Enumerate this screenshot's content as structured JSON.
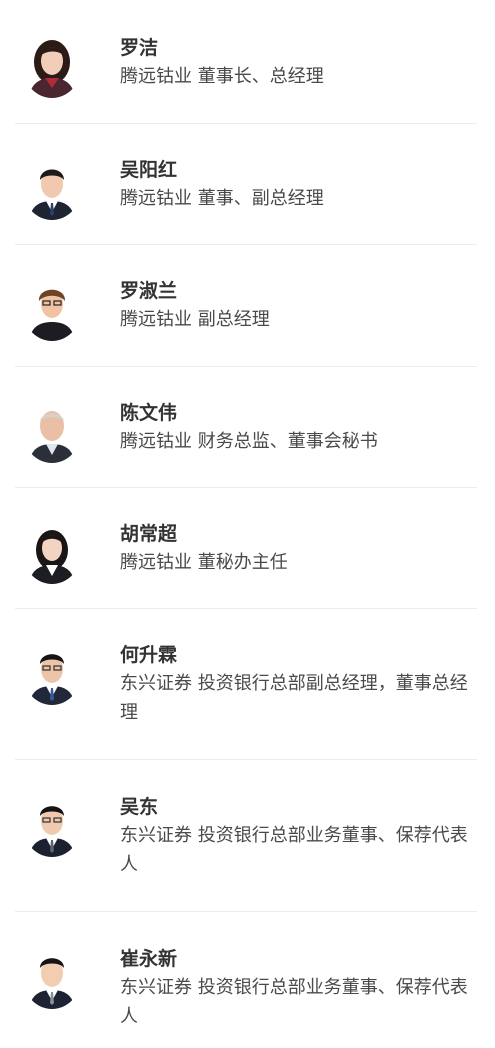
{
  "people": [
    {
      "name": "罗洁",
      "title": "腾远钴业 董事长、总经理",
      "avatar": {
        "icon": "person-portrait-icon",
        "skin": "#f2cdb8",
        "hair": "#2b1a15",
        "suit": "#4a2630",
        "shirt": "#b02a3a",
        "bg": "#ffffff"
      }
    },
    {
      "name": "吴阳红",
      "title": "腾远钴业 董事、副总经理",
      "avatar": {
        "icon": "person-portrait-icon",
        "skin": "#f0c9ae",
        "hair": "#1e1a1a",
        "suit": "#1f2433",
        "shirt": "#ffffff",
        "bg": "#ffffff"
      }
    },
    {
      "name": "罗淑兰",
      "title": "腾远钴业 副总经理",
      "avatar": {
        "icon": "person-portrait-icon",
        "skin": "#f1c3a4",
        "hair": "#6e4326",
        "suit": "#1c1c22",
        "shirt": "#2b2b33",
        "bg": "#ffffff"
      }
    },
    {
      "name": "陈文伟",
      "title": "腾远钴业 财务总监、董事会秘书",
      "avatar": {
        "icon": "person-portrait-icon",
        "skin": "#e9c0a6",
        "hair": "#d8cfc8",
        "suit": "#2b2f3a",
        "shirt": "#dfe6ee",
        "bg": "#ffffff"
      }
    },
    {
      "name": "胡常超",
      "title": "腾远钴业 董秘办主任",
      "avatar": {
        "icon": "person-portrait-icon",
        "skin": "#f3d3c1",
        "hair": "#1b1616",
        "suit": "#1d1d24",
        "shirt": "#ffffff",
        "bg": "#ffffff"
      }
    },
    {
      "name": "何升霖",
      "title": "东兴证券 投资银行总部副总经理，董事总经理",
      "avatar": {
        "icon": "person-portrait-icon",
        "skin": "#ecc4a8",
        "hair": "#151515",
        "suit": "#20283a",
        "shirt": "#ffffff",
        "bg": "#ffffff"
      }
    },
    {
      "name": "吴东",
      "title": "东兴证券 投资银行总部业务董事、保荐代表人",
      "avatar": {
        "icon": "person-portrait-icon",
        "skin": "#f0caae",
        "hair": "#141414",
        "suit": "#1c2130",
        "shirt": "#ffffff",
        "bg": "#ffffff"
      }
    },
    {
      "name": "崔永新",
      "title": "东兴证券 投资银行总部业务董事、保荐代表人",
      "avatar": {
        "icon": "person-portrait-icon",
        "skin": "#f2cdb0",
        "hair": "#181414",
        "suit": "#1e2332",
        "shirt": "#ffffff",
        "bg": "#ffffff"
      }
    }
  ]
}
